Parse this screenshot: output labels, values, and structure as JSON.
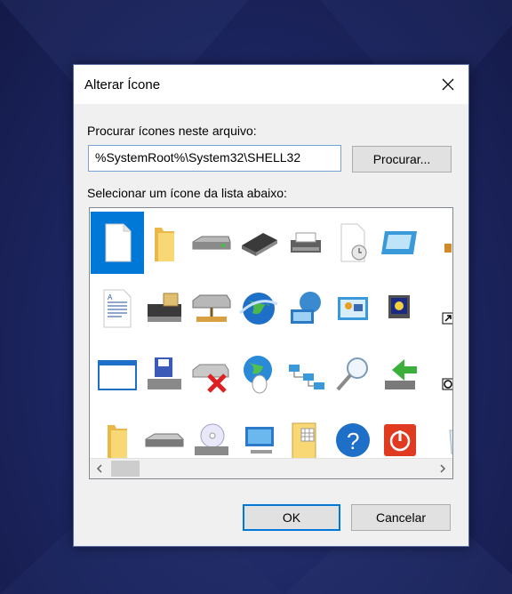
{
  "dialog": {
    "title": "Alterar Ícone",
    "file_label": "Procurar ícones neste arquivo:",
    "file_path": "%SystemRoot%\\System32\\SHELL32",
    "browse_label": "Procurar...",
    "list_label": "Selecionar um ícone da lista abaixo:",
    "ok_label": "OK",
    "cancel_label": "Cancelar"
  },
  "icons": [
    [
      "blank-document-icon",
      "folder-icon",
      "drive-icon",
      "memory-chip-icon",
      "printer-icon",
      "clock-document-icon",
      "display-window-icon",
      "partial-icon"
    ],
    [
      "text-document-icon",
      "network-drive-icon",
      "shared-drive-icon",
      "globe-icon",
      "network-globe-icon",
      "control-panel-icon",
      "screensaver-icon",
      "shortcut-arrow-icon"
    ],
    [
      "window-icon",
      "floppy-computer-icon",
      "disconnected-drive-icon",
      "globe-mouse-icon",
      "network-icon",
      "search-icon",
      "export-icon",
      "partial-icon"
    ],
    [
      "folder-icon",
      "disk-drive-icon",
      "cd-drive-icon",
      "monitor-icon",
      "document-grid-icon",
      "help-icon",
      "power-icon",
      "recycle-bin-icon"
    ]
  ],
  "selected_index": 0,
  "colors": {
    "accent": "#0078d7",
    "background": "#1c2560"
  }
}
